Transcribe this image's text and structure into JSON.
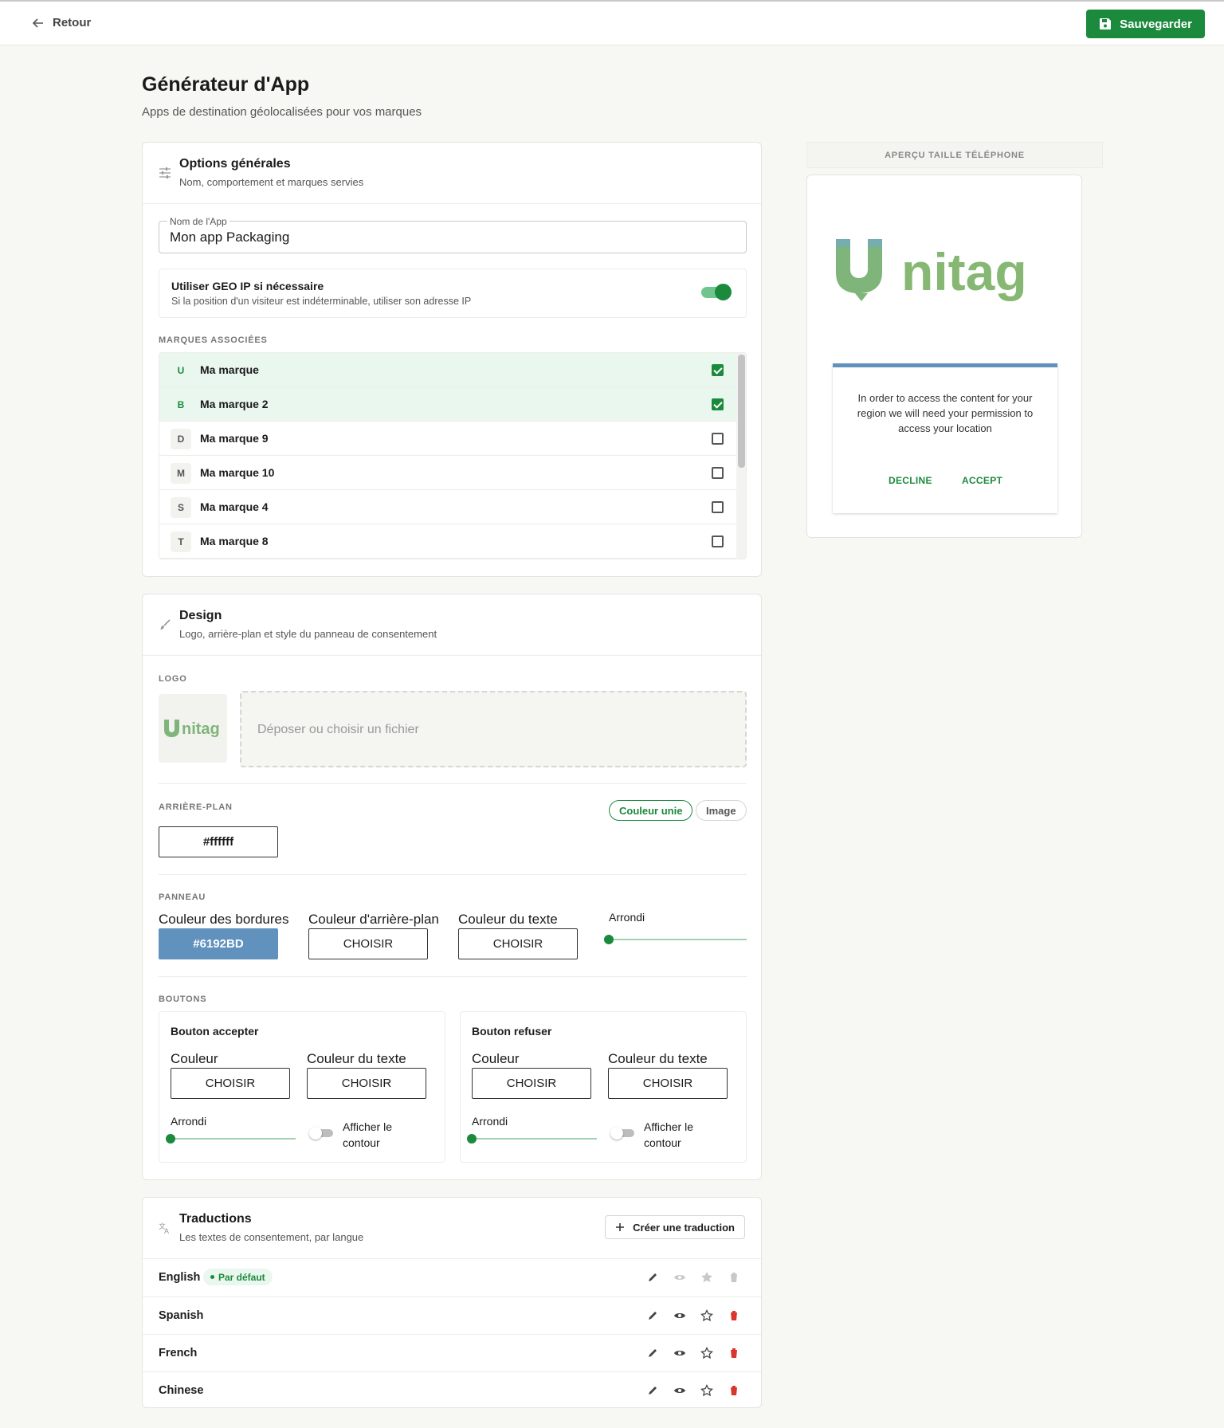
{
  "topbar": {
    "back_label": "Retour",
    "save_label": "Sauvegarder"
  },
  "page": {
    "title": "Générateur d'App",
    "subtitle": "Apps de destination géolocalisées pour vos marques"
  },
  "general": {
    "title": "Options générales",
    "subtitle": "Nom, comportement et marques servies",
    "name_label": "Nom de l'App",
    "name_value": "Mon app Packaging",
    "geo_title": "Utiliser GEO IP si nécessaire",
    "geo_desc": "Si la position d'un visiteur est indéterminable, utiliser son adresse IP",
    "geo_enabled": true,
    "brands_label": "MARQUES ASSOCIÉES",
    "brands": [
      {
        "initial": "U",
        "name": "Ma marque",
        "checked": true
      },
      {
        "initial": "B",
        "name": "Ma marque 2",
        "checked": true
      },
      {
        "initial": "D",
        "name": "Ma marque 9",
        "checked": false
      },
      {
        "initial": "M",
        "name": "Ma marque 10",
        "checked": false
      },
      {
        "initial": "S",
        "name": "Ma marque 4",
        "checked": false
      },
      {
        "initial": "T",
        "name": "Ma marque 8",
        "checked": false
      }
    ]
  },
  "design": {
    "title": "Design",
    "subtitle": "Logo, arrière-plan et style du panneau de consentement",
    "logo_label": "LOGO",
    "logo_text": "nitag",
    "drop_text": "Déposer ou choisir un fichier",
    "background_label": "ARRIÈRE-PLAN",
    "bg_option_solid": "Couleur unie",
    "bg_option_image": "Image",
    "bg_color": "#ffffff",
    "panel_label": "PANNEAU",
    "border_color_label": "Couleur des bordures",
    "border_color": "#6192BD",
    "panel_bg_label": "Couleur d'arrière-plan",
    "panel_text_label": "Couleur du texte",
    "choose": "CHOISIR",
    "rounding_label": "Arrondi",
    "buttons_label": "BOUTONS",
    "accept_title": "Bouton accepter",
    "decline_title": "Bouton refuser",
    "color_label": "Couleur",
    "text_color_label": "Couleur du texte",
    "contour_line1": "Afficher le",
    "contour_line2": "contour"
  },
  "translations": {
    "title": "Traductions",
    "subtitle": "Les textes de consentement, par langue",
    "create_label": "Créer une traduction",
    "default_badge": "Par défaut",
    "rows": [
      {
        "lang": "English",
        "default": true
      },
      {
        "lang": "Spanish",
        "default": false
      },
      {
        "lang": "French",
        "default": false
      },
      {
        "lang": "Chinese",
        "default": false
      }
    ]
  },
  "preview": {
    "label": "APERÇU TAILLE TÉLÉPHONE",
    "logo_text": "nitag",
    "message": "In order to access the content for your region we will need your permission to access your location",
    "decline": "DECLINE",
    "accept": "ACCEPT"
  },
  "colors": {
    "accent": "#1b8a3c",
    "border": "#6192BD"
  }
}
